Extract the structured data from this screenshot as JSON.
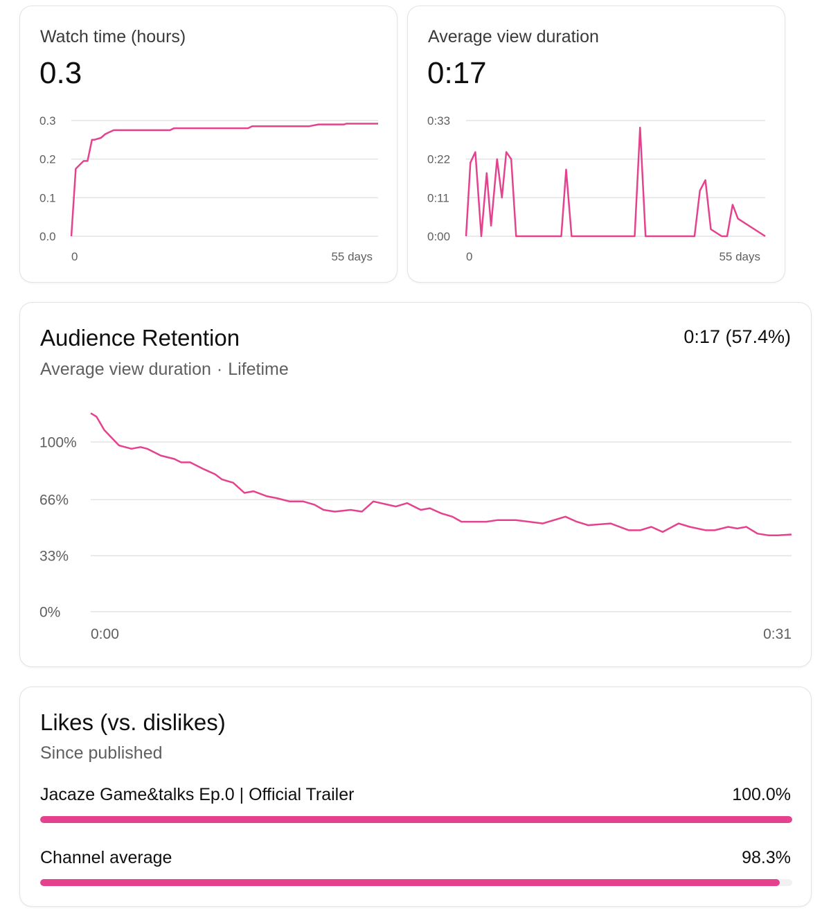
{
  "colors": {
    "accent": "#e4418e",
    "grid": "#e3e3e3",
    "card_border": "#e3e3e3"
  },
  "watch_time": {
    "title": "Watch time (hours)",
    "value": "0.3",
    "x_start_label": "0",
    "x_end_label": "55 days",
    "y_tick_labels": [
      "0.0",
      "0.1",
      "0.2",
      "0.3"
    ]
  },
  "avg_view_duration": {
    "title": "Average view duration",
    "value": "0:17",
    "x_start_label": "0",
    "x_end_label": "55 days",
    "y_tick_labels": [
      "0:00",
      "0:11",
      "0:22",
      "0:33"
    ]
  },
  "retention": {
    "title": "Audience Retention",
    "value": "0:17 (57.4%)",
    "subtitle_metric": "Average view duration",
    "subtitle_separator": "·",
    "subtitle_period": "Lifetime",
    "x_start_label": "0:00",
    "x_end_label": "0:31",
    "y_tick_labels": [
      "0%",
      "33%",
      "66%",
      "100%"
    ]
  },
  "likes": {
    "title": "Likes (vs. dislikes)",
    "subtitle": "Since published",
    "rows": [
      {
        "label": "Jacaze Game&talks Ep.0 | Official Trailer",
        "value_text": "100.0%",
        "fraction": 1.0
      },
      {
        "label": "Channel average",
        "value_text": "98.3%",
        "fraction": 0.983
      }
    ]
  },
  "chart_data": [
    {
      "type": "line",
      "title": "Watch time (hours)",
      "xlabel": "",
      "ylabel": "",
      "xlim": [
        0,
        55
      ],
      "ylim": [
        0,
        0.3
      ],
      "yticks": [
        0.0,
        0.1,
        0.2,
        0.3
      ],
      "grid": true,
      "series": [
        {
          "x": [
            0,
            0.8,
            2.2,
            2.9,
            3.7,
            4.1,
            5.3,
            6.1,
            7.6,
            8.9,
            12.7,
            17.7,
            18.4,
            31.7,
            32.4,
            42.6,
            44.3,
            48.9,
            49.3,
            55
          ],
          "y": [
            0.0,
            0.175,
            0.195,
            0.195,
            0.25,
            0.25,
            0.255,
            0.265,
            0.275,
            0.275,
            0.275,
            0.275,
            0.28,
            0.28,
            0.285,
            0.285,
            0.29,
            0.29,
            0.292,
            0.292
          ]
        }
      ]
    },
    {
      "type": "line",
      "title": "Average view duration",
      "xlabel": "",
      "ylabel": "",
      "xlim": [
        0,
        55
      ],
      "ylim": [
        0,
        33
      ],
      "yticks_seconds": [
        0,
        11,
        22,
        33
      ],
      "grid": true,
      "series": [
        {
          "x": [
            0,
            0.8,
            1.7,
            2.8,
            3.8,
            4.6,
            5.7,
            6.6,
            7.4,
            8.3,
            9.2,
            17.5,
            18.4,
            19.4,
            31.0,
            32.0,
            33.0,
            42.0,
            43.0,
            44.0,
            45.0,
            47.0,
            48.0,
            49.0,
            50.0,
            55
          ],
          "y": [
            0,
            21,
            24,
            0,
            18,
            3,
            22,
            11,
            24,
            22,
            0,
            0,
            19,
            0,
            0,
            31,
            0,
            0,
            13,
            16,
            2,
            0,
            0,
            9,
            5,
            0
          ]
        }
      ]
    },
    {
      "type": "line",
      "title": "Audience Retention",
      "subtitle": "Average view duration · Lifetime",
      "xlabel": "",
      "ylabel": "",
      "xlim": [
        0,
        31
      ],
      "ylim": [
        0,
        100
      ],
      "yticks_percent": [
        0,
        33,
        66,
        100
      ],
      "grid": true,
      "series": [
        {
          "x": [
            0,
            0.25,
            0.6,
            1.25,
            1.8,
            2.2,
            2.5,
            3.1,
            3.7,
            4.0,
            4.4,
            5.0,
            5.5,
            5.8,
            6.3,
            6.8,
            7.2,
            7.8,
            8.2,
            8.8,
            9.4,
            9.9,
            10.3,
            10.8,
            11.5,
            12.0,
            12.5,
            13.5,
            14.0,
            14.6,
            15.0,
            15.5,
            16.0,
            16.4,
            16.8,
            17.5,
            18.0,
            18.8,
            20.0,
            21.0,
            21.5,
            22.0,
            23.0,
            23.8,
            24.3,
            24.8,
            25.3,
            26.0,
            26.5,
            27.2,
            27.6,
            28.2,
            28.6,
            29.0,
            29.5,
            30.0,
            30.4,
            31
          ],
          "y": [
            117,
            115,
            107,
            98,
            96,
            97,
            96,
            92,
            90,
            88,
            88,
            84,
            81,
            78,
            76,
            70,
            71,
            68,
            67,
            65,
            65,
            63,
            60,
            59,
            60,
            59,
            65,
            62,
            64,
            60,
            61,
            58,
            56,
            53,
            53,
            53,
            54,
            54,
            52,
            56,
            53,
            51,
            52,
            48,
            48,
            50,
            47,
            52,
            50,
            48,
            48,
            50,
            49,
            50,
            46,
            45,
            45,
            45.5
          ]
        }
      ]
    },
    {
      "type": "bar",
      "title": "Likes (vs. dislikes)",
      "subtitle": "Since published",
      "categories": [
        "Jacaze Game&talks Ep.0 | Official Trailer",
        "Channel average"
      ],
      "values": [
        100.0,
        98.3
      ],
      "ylim": [
        0,
        100
      ]
    }
  ]
}
